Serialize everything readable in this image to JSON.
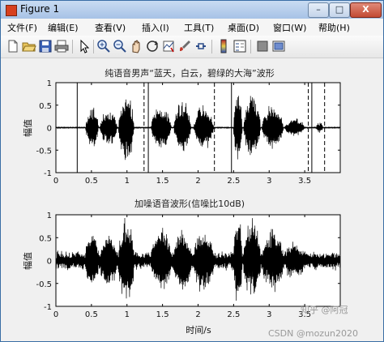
{
  "window": {
    "title": "Figure 1",
    "controls": {
      "minimize": "–",
      "maximize": "□",
      "close": "X"
    }
  },
  "menu": [
    "文件(F)",
    "编辑(E)",
    "查看(V)",
    "插入(I)",
    "工具(T)",
    "桌面(D)",
    "窗口(W)",
    "帮助(H)"
  ],
  "toolbar": [
    "new-figure-icon",
    "open-file-icon",
    "save-icon",
    "print-icon",
    "pointer-icon",
    "zoom-in-icon",
    "zoom-out-icon",
    "pan-icon",
    "rotate-icon",
    "data-cursor-icon",
    "brush-icon",
    "link-plot-icon",
    "colorbar-icon",
    "legend-icon",
    "hide-plot-tools-icon",
    "show-plot-tools-icon"
  ],
  "colors": {
    "waveform": "#000000",
    "axes_bg": "#ffffff",
    "figure_bg": "#f0f0f0"
  },
  "chart_data": [
    {
      "type": "line",
      "title": "纯语音男声“蓝天，白云，碧绿的大海”波形",
      "xlabel": "",
      "ylabel": "幅值",
      "xlim": [
        0,
        4
      ],
      "ylim": [
        -1,
        1
      ],
      "xticks": [
        "0",
        "0.5",
        "1",
        "1.5",
        "2",
        "2.5",
        "3",
        "3.5"
      ],
      "yticks": [
        "1",
        "0.5",
        "0",
        "-0.5",
        "-1"
      ],
      "series": [
        {
          "segments": [
            {
              "start": 0.3,
              "end": 1.14,
              "bursts": [
                [
                  0.42,
                  0.6,
                  0.5
                ],
                [
                  0.62,
                  0.86,
                  0.45
                ],
                [
                  0.88,
                  1.1,
                  0.85
                ]
              ]
            },
            {
              "start": 1.3,
              "end": 2.23,
              "bursts": [
                [
                  1.34,
                  1.62,
                  0.55
                ],
                [
                  1.66,
                  1.9,
                  0.65
                ],
                [
                  1.94,
                  2.22,
                  0.55
                ]
              ]
            },
            {
              "start": 2.47,
              "end": 3.55,
              "bursts": [
                [
                  2.5,
                  2.62,
                  0.98
                ],
                [
                  2.64,
                  2.88,
                  0.8
                ],
                [
                  2.9,
                  3.2,
                  0.55
                ],
                [
                  3.22,
                  3.5,
                  0.22
                ]
              ]
            },
            {
              "start": 3.6,
              "end": 3.78,
              "bursts": [
                [
                  3.66,
                  3.76,
                  0.12
                ]
              ]
            }
          ]
        }
      ],
      "solid_markers": [
        0.3,
        1.3,
        2.47,
        3.6
      ],
      "dashed_markers": [
        1.24,
        2.23,
        3.55,
        3.78
      ]
    },
    {
      "type": "line",
      "title": "加噪语音波形(信噪比10dB)",
      "xlabel": "时间/s",
      "ylabel": "幅值",
      "xlim": [
        0,
        4
      ],
      "ylim": [
        -1,
        1
      ],
      "xticks": [
        "0",
        "0.5",
        "1",
        "1.5",
        "2",
        "2.5",
        "3",
        "3.5"
      ],
      "yticks": [
        "1",
        "0.5",
        "0",
        "-0.5",
        "-1"
      ],
      "snr_db": 10,
      "noise_amplitude": 0.15,
      "series": [
        {
          "bursts": [
            [
              0.42,
              0.6,
              0.5
            ],
            [
              0.62,
              0.86,
              0.45
            ],
            [
              0.88,
              1.1,
              0.85
            ],
            [
              1.34,
              1.62,
              0.55
            ],
            [
              1.66,
              1.9,
              0.65
            ],
            [
              1.94,
              2.22,
              0.55
            ],
            [
              2.5,
              2.62,
              0.98
            ],
            [
              2.64,
              2.88,
              0.8
            ],
            [
              2.9,
              3.2,
              0.55
            ],
            [
              3.22,
              3.5,
              0.22
            ]
          ]
        }
      ]
    }
  ],
  "watermark": {
    "line1": "知乎 @阿冠",
    "line2": "CSDN @mozun2020"
  }
}
